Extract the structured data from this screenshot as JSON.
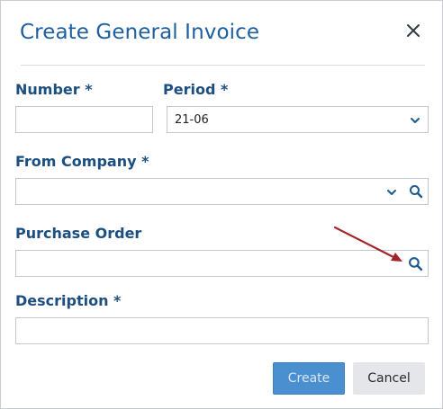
{
  "dialog": {
    "title": "Create General Invoice",
    "close_icon": "close-icon"
  },
  "form": {
    "number": {
      "label": "Number *",
      "value": ""
    },
    "period": {
      "label": "Period *",
      "value": "21-06"
    },
    "from_company": {
      "label": "From Company *",
      "value": ""
    },
    "purchase_order": {
      "label": "Purchase Order",
      "value": ""
    },
    "description": {
      "label": "Description *",
      "value": ""
    }
  },
  "buttons": {
    "create_label": "Create",
    "cancel_label": "Cancel"
  },
  "colors": {
    "title": "#1e5fa0",
    "label": "#1c4f80",
    "primary": "#4a8fcf",
    "annotation_arrow": "#a32329"
  }
}
